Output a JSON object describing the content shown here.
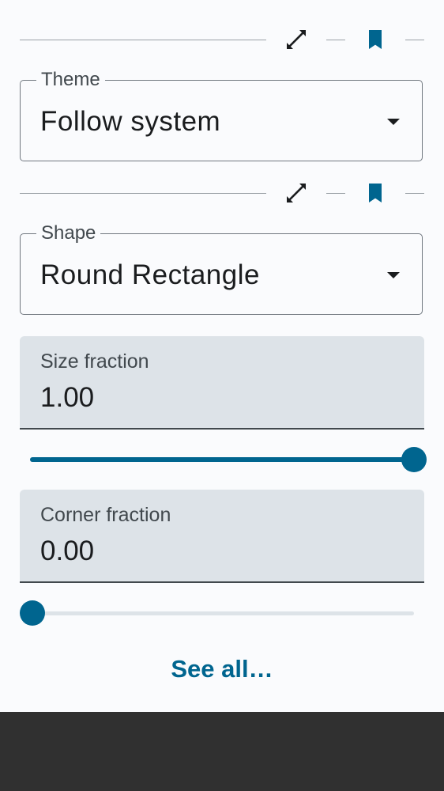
{
  "theme_section": {
    "expand_icon": "expand-diagonal-icon",
    "bookmark_icon": "bookmark-icon",
    "label": "Theme",
    "value": "Follow system"
  },
  "shape_section": {
    "expand_icon": "expand-diagonal-icon",
    "bookmark_icon": "bookmark-icon",
    "label": "Shape",
    "value": "Round Rectangle"
  },
  "size_fraction": {
    "label": "Size fraction",
    "value": "1.00",
    "slider_level": 1.0
  },
  "corner_fraction": {
    "label": "Corner fraction",
    "value": "0.00",
    "slider_level": 0.0
  },
  "see_all_label": "See all…",
  "colors": {
    "accent": "#00658f",
    "field_bg": "#dde3e8",
    "background": "#fafbfd",
    "bottom_bar": "#303030"
  }
}
